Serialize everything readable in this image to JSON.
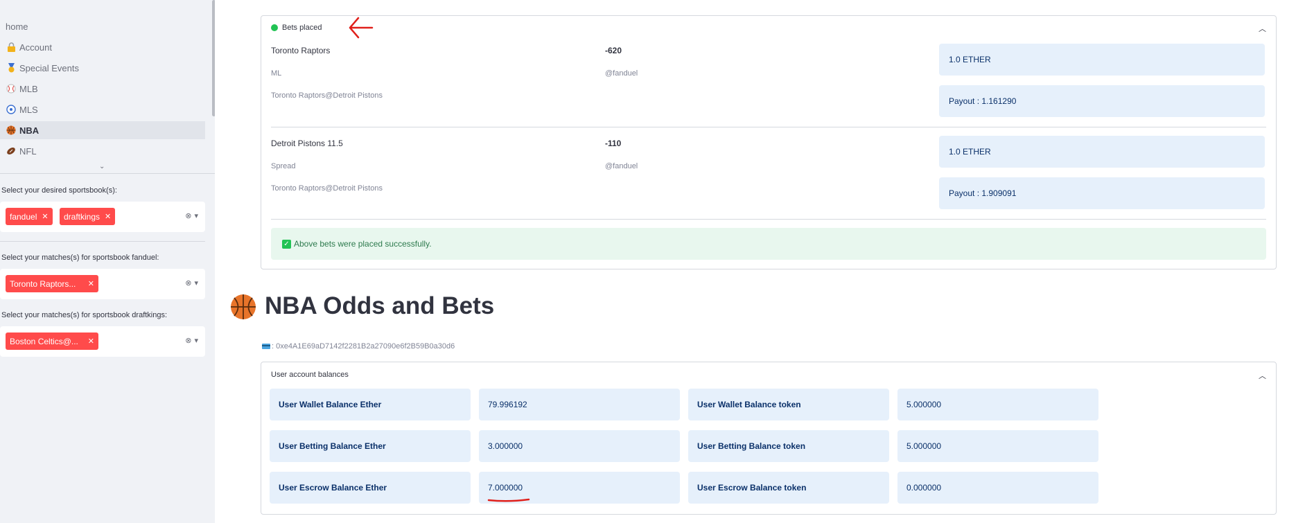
{
  "sidebar": {
    "nav": {
      "home": "home",
      "items": [
        {
          "label": "Account",
          "icon": "lock-icon"
        },
        {
          "label": "Special Events",
          "icon": "medal-icon"
        },
        {
          "label": "MLB",
          "icon": "baseball-icon"
        },
        {
          "label": "MLS",
          "icon": "soccer-ball-icon"
        },
        {
          "label": "NBA",
          "icon": "basketball-icon",
          "active": true
        },
        {
          "label": "NFL",
          "icon": "football-icon"
        }
      ]
    },
    "sportsbooks": {
      "label": "Select your desired sportsbook(s):",
      "chips": [
        "fanduel",
        "draftkings"
      ]
    },
    "matches_fanduel": {
      "label": "Select your matches(s) for sportsbook fanduel:",
      "chips": [
        "Toronto Raptors..."
      ]
    },
    "matches_draftkings": {
      "label": "Select your matches(s) for sportsbook draftkings:",
      "chips": [
        "Boston Celtics@..."
      ]
    }
  },
  "bets_placed": {
    "title": "Bets placed",
    "bets": [
      {
        "team": "Toronto Raptors",
        "type": "ML",
        "match": "Toronto Raptors@Detroit Pistons",
        "odds": "-620",
        "book": "@fanduel",
        "stake": "1.0 ETHER",
        "payout": "Payout : 1.161290"
      },
      {
        "team": "Detroit Pistons 11.5",
        "type": "Spread",
        "match": "Toronto Raptors@Detroit Pistons",
        "odds": "-110",
        "book": "@fanduel",
        "stake": "1.0 ETHER",
        "payout": "Payout : 1.909091"
      }
    ],
    "success": "Above bets were placed successfully."
  },
  "page": {
    "title": "NBA Odds and Bets",
    "wallet": ": 0xe4A1E69aD7142f2281B2a27090e6f2B59B0a30d6"
  },
  "balances": {
    "title": "User account balances",
    "rows": [
      {
        "ether_label": "User Wallet Balance Ether",
        "ether_value": "79.996192",
        "token_label": "User Wallet Balance token",
        "token_value": "5.000000"
      },
      {
        "ether_label": "User Betting Balance Ether",
        "ether_value": "3.000000",
        "token_label": "User Betting Balance token",
        "token_value": "5.000000"
      },
      {
        "ether_label": "User Escrow Balance Ether",
        "ether_value": "7.000000",
        "token_label": "User Escrow Balance token",
        "token_value": "0.000000"
      }
    ]
  },
  "colors": {
    "accent": "#ff4b4b",
    "success": "#21c354",
    "info_bg": "#e6f0fb",
    "annotation": "#e0201b"
  }
}
